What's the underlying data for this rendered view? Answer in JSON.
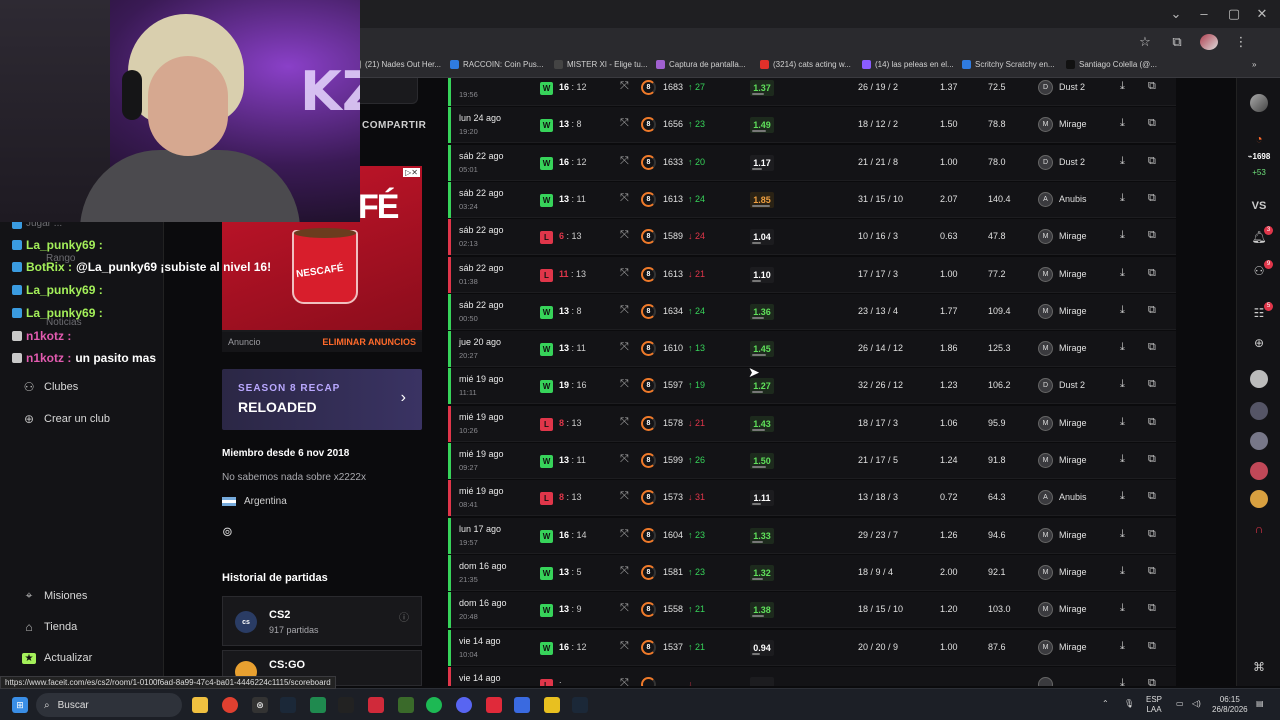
{
  "browser": {
    "bookmarks": [
      {
        "label": "(21) Nades Out Her...",
        "color": "#8b8b8b"
      },
      {
        "label": "RACCOIN: Coin Pus...",
        "color": "#2f7be0"
      },
      {
        "label": "MISTER XI - Elige tu...",
        "color": "#444"
      },
      {
        "label": "Captura de pantalla...",
        "color": "#a060d0"
      },
      {
        "label": "(3214) cats acting w...",
        "color": "#e0302a"
      },
      {
        "label": "(14) las peleas en el...",
        "color": "#8a5cff"
      },
      {
        "label": "Scritchy Scratchy en...",
        "color": "#2f7be0"
      },
      {
        "label": "Santiago Colella (@...",
        "color": "#111"
      }
    ],
    "status_url": "https://www.faceit.com/es/cs2/room/1-0100f6ad-8a99-47c4-ba01-4446224c1115/scoreboard"
  },
  "chat": [
    {
      "name": "Jugar ...",
      "text": "",
      "ghost": true
    },
    {
      "name": "La_punky69 :",
      "text": "",
      "color": "green"
    },
    {
      "name": "BotRix :",
      "text": "@La_punky69 ¡subiste al nivel 16!",
      "color": "green"
    },
    {
      "name": "La_punky69 :",
      "text": "",
      "color": "green"
    },
    {
      "name": "La_punky69 :",
      "text": "",
      "color": "green"
    },
    {
      "name": "n1kotz :",
      "text": "",
      "color": "pink"
    },
    {
      "name": "n1kotz :",
      "text": "un pasito mas",
      "color": "pink"
    }
  ],
  "chat_ghosts": {
    "rango": "Rango",
    "noticias": "Noticias"
  },
  "sidebar": {
    "items": [
      {
        "label": "Clubes",
        "icon": "clubs-icon"
      },
      {
        "label": "Crear un club",
        "icon": "plus-circle-icon"
      },
      {
        "label": "Misiones",
        "icon": "missions-icon"
      },
      {
        "label": "Tienda",
        "icon": "shop-icon"
      },
      {
        "label": "Actualizar",
        "icon": "upgrade-icon"
      }
    ]
  },
  "profile": {
    "share_label": "COMPARTIR",
    "ad": {
      "brand": "FÉ",
      "mug_text": "NESCAFÉ",
      "label": "Anuncio",
      "remove": "ELIMINAR ANUNCIOS"
    },
    "recap": {
      "subtitle": "SEASON 8 RECAP",
      "title": "RELOADED"
    },
    "member_since": "Miembro desde 6 nov 2018",
    "bio": "No sabemos nada sobre x2222x",
    "country": "Argentina",
    "history_title": "Historial de partidas",
    "games": [
      {
        "logo": "cs",
        "name": "CS2",
        "sub": "917 partidas"
      },
      {
        "logo": "",
        "name": "CS:GO",
        "sub": ""
      }
    ]
  },
  "matches": [
    {
      "date": "",
      "time": "19:56",
      "result": "W",
      "score_a": "16",
      "score_b": "12",
      "level": "8",
      "elo": "1683",
      "delta": "27",
      "dir": "up",
      "kd": "1.37",
      "kd_fill": 0.6,
      "kda": "26 / 19 / 2",
      "kr": "1.37",
      "adr": "72.5",
      "map": "Dust 2",
      "map_icon": "D"
    },
    {
      "date": "lun 24 ago",
      "time": "19:20",
      "result": "W",
      "score_a": "13",
      "score_b": "8",
      "level": "8",
      "elo": "1656",
      "delta": "23",
      "dir": "up",
      "kd": "1.49",
      "kd_fill": 0.7,
      "kda": "18 / 12 / 2",
      "kr": "1.50",
      "adr": "78.8",
      "map": "Mirage",
      "map_icon": "M"
    },
    {
      "date": "sáb 22 ago",
      "time": "05:01",
      "result": "W",
      "score_a": "16",
      "score_b": "12",
      "level": "8",
      "elo": "1633",
      "delta": "20",
      "dir": "up",
      "kd": "1.17",
      "kd_fill": 0.5,
      "kda": "21 / 21 / 8",
      "kr": "1.00",
      "adr": "78.0",
      "map": "Dust 2",
      "map_icon": "D"
    },
    {
      "date": "sáb 22 ago",
      "time": "03:24",
      "result": "W",
      "score_a": "13",
      "score_b": "11",
      "level": "8",
      "elo": "1613",
      "delta": "24",
      "dir": "up",
      "kd": "1.85",
      "kd_fill": 0.9,
      "kda": "31 / 15 / 10",
      "kr": "2.07",
      "adr": "140.4",
      "map": "Anubis",
      "map_icon": "A"
    },
    {
      "date": "sáb 22 ago",
      "time": "02:13",
      "result": "L",
      "score_a": "6",
      "score_b": "13",
      "level": "8",
      "elo": "1589",
      "delta": "24",
      "dir": "dn",
      "kd": "1.04",
      "kd_fill": 0.45,
      "kda": "10 / 16 / 3",
      "kr": "0.63",
      "adr": "47.8",
      "map": "Mirage",
      "map_icon": "M"
    },
    {
      "date": "sáb 22 ago",
      "time": "01:38",
      "result": "L",
      "score_a": "11",
      "score_b": "13",
      "level": "8",
      "elo": "1613",
      "delta": "21",
      "dir": "dn",
      "kd": "1.10",
      "kd_fill": 0.45,
      "kda": "17 / 17 / 3",
      "kr": "1.00",
      "adr": "77.2",
      "map": "Mirage",
      "map_icon": "M"
    },
    {
      "date": "sáb 22 ago",
      "time": "00:50",
      "result": "W",
      "score_a": "13",
      "score_b": "8",
      "level": "8",
      "elo": "1634",
      "delta": "24",
      "dir": "up",
      "kd": "1.36",
      "kd_fill": 0.6,
      "kda": "23 / 13 / 4",
      "kr": "1.77",
      "adr": "109.4",
      "map": "Mirage",
      "map_icon": "M"
    },
    {
      "date": "jue 20 ago",
      "time": "20:27",
      "result": "W",
      "score_a": "13",
      "score_b": "11",
      "level": "8",
      "elo": "1610",
      "delta": "13",
      "dir": "up",
      "kd": "1.45",
      "kd_fill": 0.7,
      "kda": "26 / 14 / 12",
      "kr": "1.86",
      "adr": "125.3",
      "map": "Mirage",
      "map_icon": "M"
    },
    {
      "date": "mié 19 ago",
      "time": "11:11",
      "result": "W",
      "score_a": "19",
      "score_b": "16",
      "level": "8",
      "elo": "1597",
      "delta": "19",
      "dir": "up",
      "kd": "1.27",
      "kd_fill": 0.55,
      "kda": "32 / 26 / 12",
      "kr": "1.23",
      "adr": "106.2",
      "map": "Dust 2",
      "map_icon": "D"
    },
    {
      "date": "mié 19 ago",
      "time": "10:26",
      "result": "L",
      "score_a": "8",
      "score_b": "13",
      "level": "8",
      "elo": "1578",
      "delta": "21",
      "dir": "dn",
      "kd": "1.43",
      "kd_fill": 0.65,
      "kda": "18 / 17 / 3",
      "kr": "1.06",
      "adr": "95.9",
      "map": "Mirage",
      "map_icon": "M"
    },
    {
      "date": "mié 19 ago",
      "time": "09:27",
      "result": "W",
      "score_a": "13",
      "score_b": "11",
      "level": "8",
      "elo": "1599",
      "delta": "26",
      "dir": "up",
      "kd": "1.50",
      "kd_fill": 0.7,
      "kda": "21 / 17 / 5",
      "kr": "1.24",
      "adr": "91.8",
      "map": "Mirage",
      "map_icon": "M"
    },
    {
      "date": "mié 19 ago",
      "time": "08:41",
      "result": "L",
      "score_a": "8",
      "score_b": "13",
      "level": "8",
      "elo": "1573",
      "delta": "31",
      "dir": "dn",
      "kd": "1.11",
      "kd_fill": 0.45,
      "kda": "13 / 18 / 3",
      "kr": "0.72",
      "adr": "64.3",
      "map": "Anubis",
      "map_icon": "A"
    },
    {
      "date": "lun 17 ago",
      "time": "19:57",
      "result": "W",
      "score_a": "16",
      "score_b": "14",
      "level": "8",
      "elo": "1604",
      "delta": "23",
      "dir": "up",
      "kd": "1.33",
      "kd_fill": 0.55,
      "kda": "29 / 23 / 7",
      "kr": "1.26",
      "adr": "94.6",
      "map": "Mirage",
      "map_icon": "M"
    },
    {
      "date": "dom 16 ago",
      "time": "21:35",
      "result": "W",
      "score_a": "13",
      "score_b": "5",
      "level": "8",
      "elo": "1581",
      "delta": "23",
      "dir": "up",
      "kd": "1.32",
      "kd_fill": 0.55,
      "kda": "18 / 9 / 4",
      "kr": "2.00",
      "adr": "92.1",
      "map": "Mirage",
      "map_icon": "M"
    },
    {
      "date": "dom 16 ago",
      "time": "20:48",
      "result": "W",
      "score_a": "13",
      "score_b": "9",
      "level": "8",
      "elo": "1558",
      "delta": "21",
      "dir": "up",
      "kd": "1.38",
      "kd_fill": 0.6,
      "kda": "18 / 15 / 10",
      "kr": "1.20",
      "adr": "103.0",
      "map": "Mirage",
      "map_icon": "M"
    },
    {
      "date": "vie 14 ago",
      "time": "10:04",
      "result": "W",
      "score_a": "16",
      "score_b": "12",
      "level": "8",
      "elo": "1537",
      "delta": "21",
      "dir": "up",
      "kd": "0.94",
      "kd_fill": 0.4,
      "kda": "20 / 20 / 9",
      "kr": "1.00",
      "adr": "87.6",
      "map": "Mirage",
      "map_icon": "M"
    },
    {
      "date": "vie 14 ago",
      "time": "",
      "result": "L",
      "score_a": "",
      "score_b": "",
      "level": "",
      "elo": "",
      "delta": "",
      "dir": "dn",
      "kd": "",
      "kd_fill": 0,
      "kda": "",
      "kr": "",
      "adr": "",
      "map": "",
      "map_icon": ""
    }
  ],
  "rightrail": {
    "elo": "1698",
    "elo_delta": "+53",
    "vs": "VS",
    "notif_bell": "3",
    "notif_friends": "9",
    "notif_party": "5"
  },
  "taskbar": {
    "search": "Buscar",
    "lang": "ESP",
    "lang2": "LAA",
    "time": "06:15",
    "date": "26/8/2026"
  },
  "colors": {
    "win": "#37d35a",
    "loss": "#e0364a",
    "accent": "#ff6a2b"
  }
}
